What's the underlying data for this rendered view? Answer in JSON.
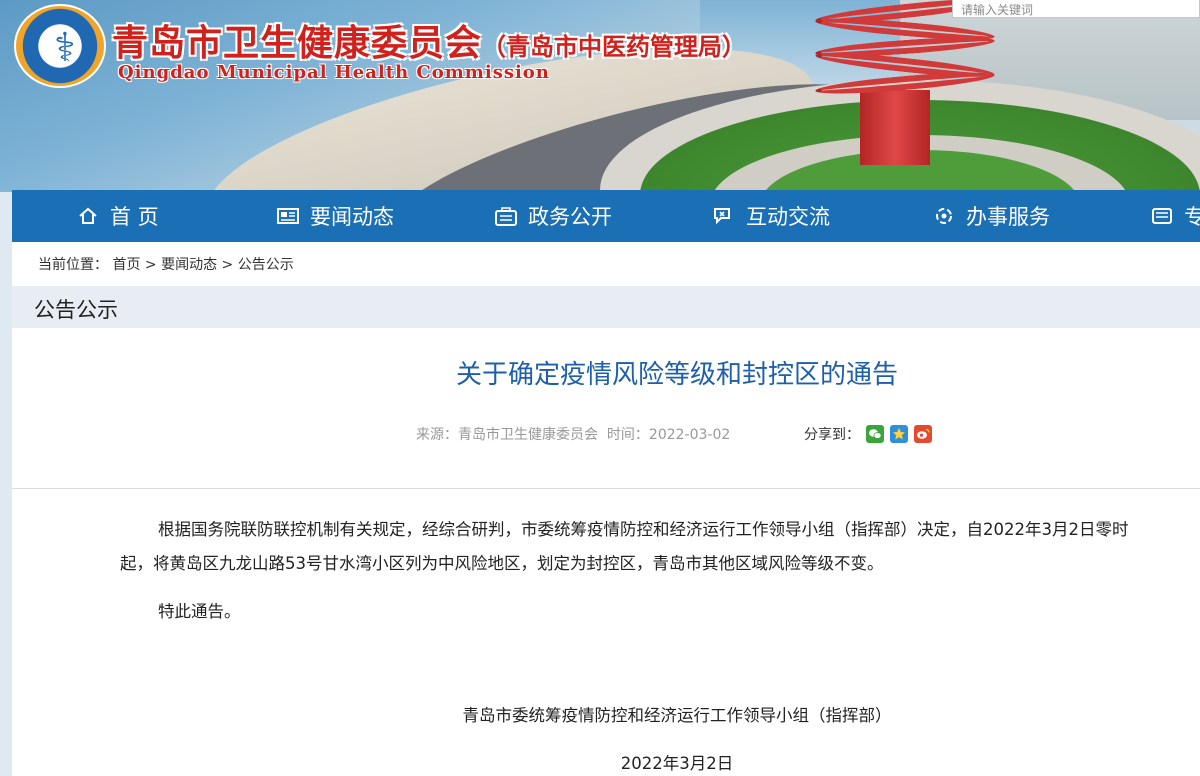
{
  "header": {
    "title": "青岛市卫生健康委员会",
    "title_suffix": "（青岛市中医药管理局）",
    "subtitle": "Qingdao Municipal Health Commission",
    "search_placeholder": "请输入关键词"
  },
  "nav": {
    "items": [
      {
        "label": "首 页",
        "icon": "home-icon"
      },
      {
        "label": "要闻动态",
        "icon": "news-icon"
      },
      {
        "label": "政务公开",
        "icon": "gov-affairs-icon"
      },
      {
        "label": "互动交流",
        "icon": "interaction-icon"
      },
      {
        "label": "办事服务",
        "icon": "service-icon"
      },
      {
        "label": "专",
        "icon": "topic-icon"
      }
    ]
  },
  "breadcrumb": {
    "prefix": "当前位置：",
    "items": [
      "首页",
      "要闻动态",
      "公告公示"
    ],
    "separator": ">"
  },
  "section": {
    "title": "公告公示"
  },
  "article": {
    "title": "关于确定疫情风险等级和封控区的通告",
    "source_label": "来源：",
    "source": "青岛市卫生健康委员会",
    "time_label": "时间：",
    "time": "2022-03-02",
    "share_label": "分享到：",
    "share_icons": [
      "wechat-icon",
      "qzone-icon",
      "weibo-icon"
    ],
    "para1_line1": "根据国务院联防联控机制有关规定，经综合研判，市委统筹疫情防控和经济运行工作领导小组（指挥部）决定，自2022年3月2日零时",
    "para1_line2": "起，将黄岛区九龙山路53号甘水湾小区列为中风险地区，划定为封控区，青岛市其他区域风险等级不变。",
    "para2": "特此通告。",
    "signature": "青岛市委统筹疫情防控和经济运行工作领导小组（指挥部）",
    "date": "2022年3月2日"
  }
}
